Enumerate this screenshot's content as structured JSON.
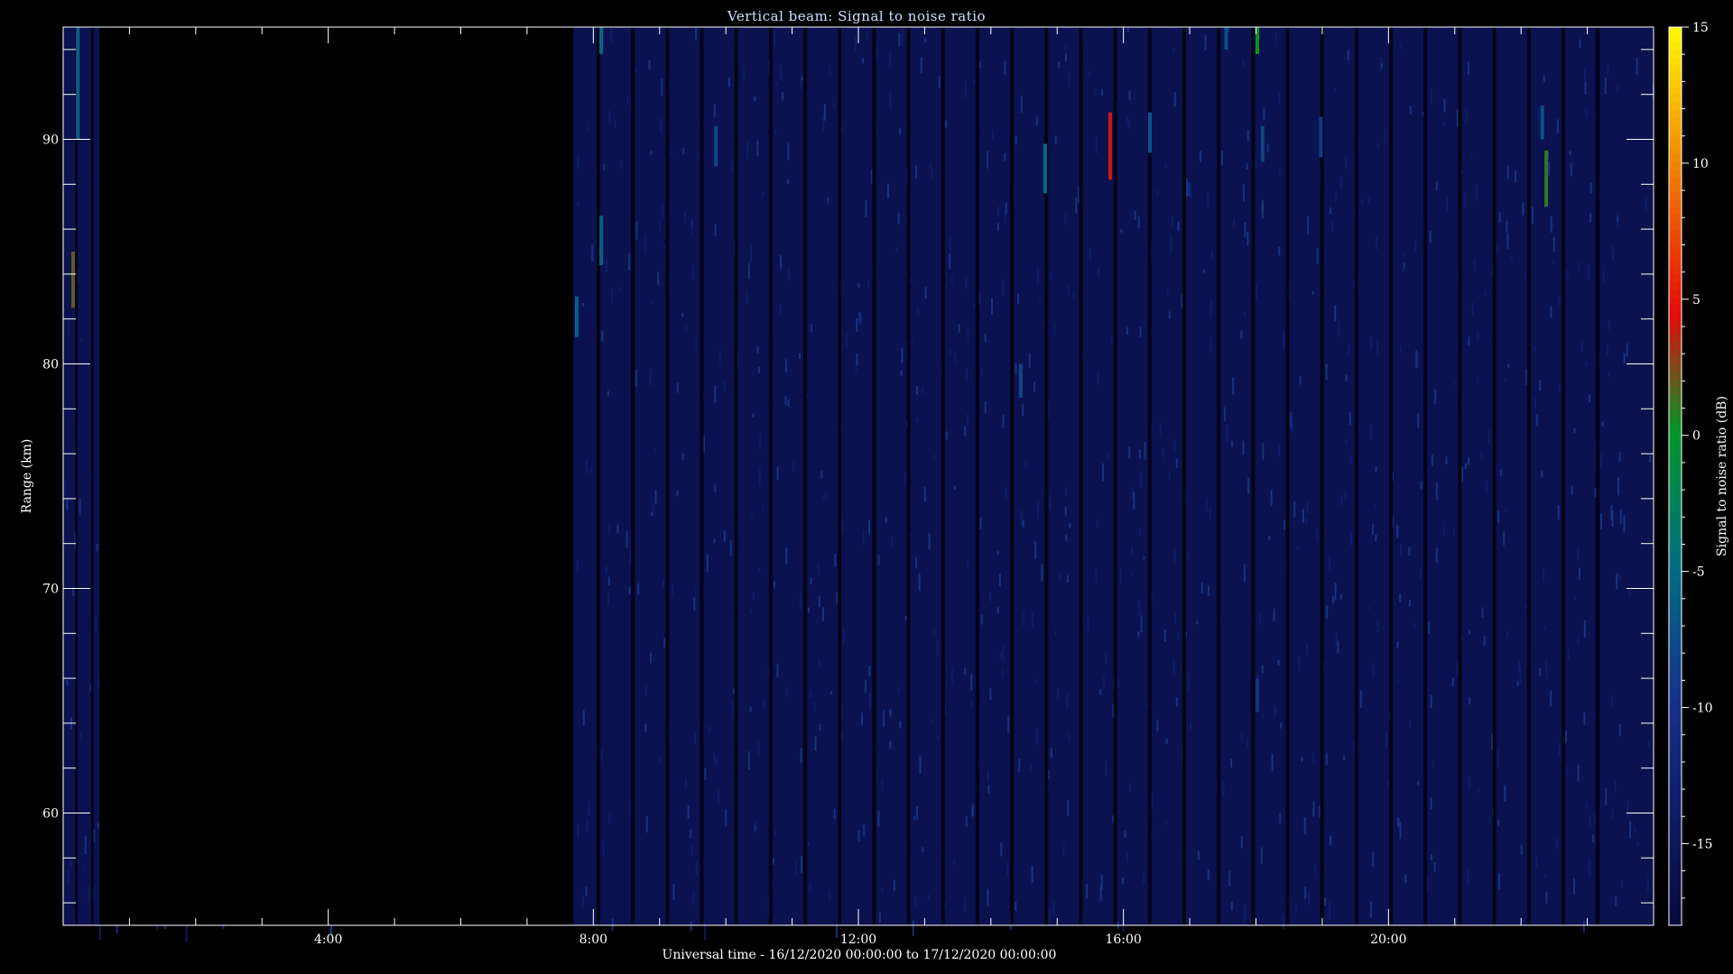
{
  "chart_data": {
    "type": "heatmap",
    "title": "Vertical beam: Signal to noise ratio",
    "xlabel": "Universal time - 16/12/2020 00:00:00 to 17/12/2020 00:00:00",
    "ylabel": "Range (km)",
    "colorbar_label": "Signal to noise ratio (dB)",
    "xlim_hours": [
      0,
      24
    ],
    "ylim_km": [
      55,
      95
    ],
    "clim_db": [
      -18,
      15
    ],
    "x_ticks": [
      {
        "value": 4,
        "label": "4:00"
      },
      {
        "value": 8,
        "label": "8:00"
      },
      {
        "value": 12,
        "label": "12:00"
      },
      {
        "value": 16,
        "label": "16:00"
      },
      {
        "value": 20,
        "label": "20:00"
      }
    ],
    "y_ticks": [
      {
        "value": 60,
        "label": "60"
      },
      {
        "value": 70,
        "label": "70"
      },
      {
        "value": 80,
        "label": "80"
      },
      {
        "value": 90,
        "label": "90"
      }
    ],
    "colorbar_ticks": [
      {
        "value": 15,
        "label": "15"
      },
      {
        "value": 10,
        "label": "10"
      },
      {
        "value": 5,
        "label": "5"
      },
      {
        "value": 0,
        "label": "0"
      },
      {
        "value": -5,
        "label": "-5"
      },
      {
        "value": -10,
        "label": "-10"
      },
      {
        "value": -15,
        "label": "-15"
      }
    ],
    "no_data_intervals_hours": [
      [
        0.55,
        7.7
      ]
    ],
    "background_snr_db": -16,
    "echoes": [
      {
        "time_h": 0.22,
        "range_start_km": 90,
        "range_end_km": 95,
        "snr_db": -6
      },
      {
        "time_h": 0.15,
        "range_start_km": 82.5,
        "range_end_km": 85,
        "snr_db": 2
      },
      {
        "time_h": 7.75,
        "range_start_km": 81.2,
        "range_end_km": 83,
        "snr_db": -6
      },
      {
        "time_h": 8.12,
        "range_start_km": 93.8,
        "range_end_km": 95,
        "snr_db": -5
      },
      {
        "time_h": 8.12,
        "range_start_km": 84.4,
        "range_end_km": 86.6,
        "snr_db": -6
      },
      {
        "time_h": 9.85,
        "range_start_km": 88.8,
        "range_end_km": 90.6,
        "snr_db": -8
      },
      {
        "time_h": 14.45,
        "range_start_km": 78.5,
        "range_end_km": 80,
        "snr_db": -8
      },
      {
        "time_h": 14.82,
        "range_start_km": 87.6,
        "range_end_km": 89.8,
        "snr_db": -5
      },
      {
        "time_h": 15.8,
        "range_start_km": 88.2,
        "range_end_km": 91.2,
        "snr_db": 4
      },
      {
        "time_h": 16.4,
        "range_start_km": 89.4,
        "range_end_km": 91.2,
        "snr_db": -7
      },
      {
        "time_h": 17.55,
        "range_start_km": 94,
        "range_end_km": 95,
        "snr_db": -7
      },
      {
        "time_h": 18.02,
        "range_start_km": 93.8,
        "range_end_km": 95,
        "snr_db": 0
      },
      {
        "time_h": 18.1,
        "range_start_km": 89,
        "range_end_km": 90.6,
        "snr_db": -8
      },
      {
        "time_h": 18.98,
        "range_start_km": 89.2,
        "range_end_km": 91,
        "snr_db": -9
      },
      {
        "time_h": 22.32,
        "range_start_km": 90,
        "range_end_km": 91.5,
        "snr_db": -7
      },
      {
        "time_h": 22.38,
        "range_start_km": 87,
        "range_end_km": 89.5,
        "snr_db": 1
      },
      {
        "time_h": 18.02,
        "range_start_km": 64.5,
        "range_end_km": 66,
        "snr_db": -10
      }
    ]
  }
}
